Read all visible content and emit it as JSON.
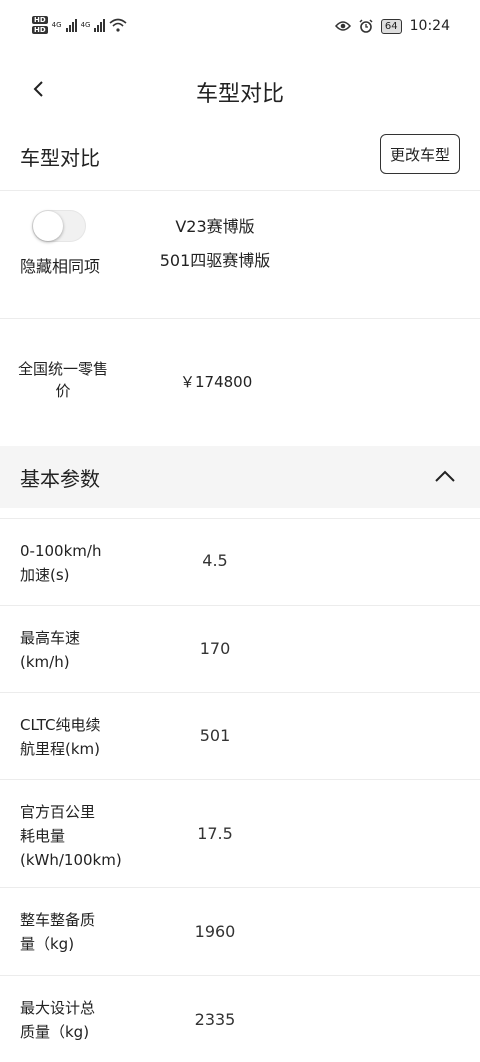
{
  "status_bar": {
    "left_badges": [
      "HD",
      "HD"
    ],
    "network_labels": [
      "4G",
      "4G"
    ],
    "icons": [
      "hd-icon",
      "signal-icon",
      "wifi-icon",
      "eye-icon",
      "alarm-icon",
      "battery-icon"
    ],
    "battery": "64",
    "time": "10:24"
  },
  "nav": {
    "title": "车型对比",
    "back_icon": "chevron-left-icon"
  },
  "section": {
    "title": "车型对比",
    "change_button": "更改车型"
  },
  "compare": {
    "toggle_label": "隐藏相同项",
    "toggle_on": false,
    "model_line1": "V23赛博版",
    "model_line2": "501四驱赛博版"
  },
  "price": {
    "label": "全国统一零售价",
    "value": "￥174800"
  },
  "basic_params": {
    "title": "基本参数",
    "collapse_icon": "chevron-up-icon",
    "rows": [
      {
        "name": "0-100km/h\n加速(s)",
        "value": "4.5"
      },
      {
        "name": "最高车速\n(km/h)",
        "value": "170"
      },
      {
        "name": "CLTC纯电续\n航里程(km)",
        "value": "501"
      },
      {
        "name": "官方百公里\n耗电量\n(kWh/100km)",
        "value": "17.5"
      },
      {
        "name": "整车整备质\n量（kg)",
        "value": "1960"
      },
      {
        "name": "最大设计总\n质量（kg)",
        "value": "2335"
      }
    ]
  },
  "colors": {
    "accent": "#222222",
    "divider": "#ececec",
    "group_bg": "#f5f5f5"
  }
}
